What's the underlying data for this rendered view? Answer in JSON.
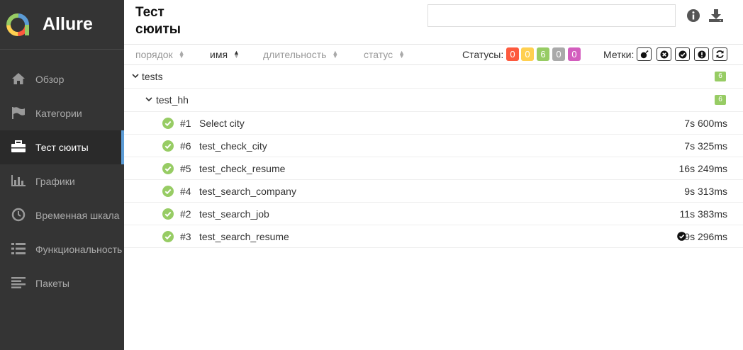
{
  "brand": {
    "name": "Allure"
  },
  "sidebar": {
    "items": [
      {
        "label": "Обзор",
        "icon": "home-icon",
        "active": false
      },
      {
        "label": "Категории",
        "icon": "flag-icon",
        "active": false
      },
      {
        "label": "Тест сюиты",
        "icon": "briefcase-icon",
        "active": true
      },
      {
        "label": "Графики",
        "icon": "bar-chart-icon",
        "active": false
      },
      {
        "label": "Временная шкала",
        "icon": "clock-icon",
        "active": false
      },
      {
        "label": "Функциональность",
        "icon": "list-icon",
        "active": false
      },
      {
        "label": "Пакеты",
        "icon": "align-left-icon",
        "active": false
      }
    ]
  },
  "header": {
    "title": "Тест сюиты",
    "search_value": "",
    "info_icon": "info-icon",
    "download_icon": "download-icon"
  },
  "toolbar": {
    "sorters": [
      {
        "label": "порядок",
        "active": false
      },
      {
        "label": "имя",
        "active": true
      },
      {
        "label": "длительность",
        "active": false
      },
      {
        "label": "статус",
        "active": false
      }
    ],
    "statuses_label": "Статусы:",
    "statuses": [
      {
        "name": "failed",
        "count": "0",
        "color": "#fd5a3e"
      },
      {
        "name": "broken",
        "count": "0",
        "color": "#ffd050"
      },
      {
        "name": "passed",
        "count": "6",
        "color": "#97cc64"
      },
      {
        "name": "skipped",
        "count": "0",
        "color": "#aaaaaa"
      },
      {
        "name": "unknown",
        "count": "0",
        "color": "#d35ebe"
      }
    ],
    "marks_label": "Метки:",
    "marks": [
      "bomb-icon",
      "times-circle-icon",
      "check-circle-icon",
      "exclamation-circle-icon",
      "refresh-icon"
    ]
  },
  "tree": {
    "groups": [
      {
        "name": "tests",
        "count": "6"
      },
      {
        "name": "test_hh",
        "count": "6"
      }
    ],
    "tests": [
      {
        "num": "#1",
        "name": "Select city",
        "duration": "7s 600ms",
        "flagged": false
      },
      {
        "num": "#6",
        "name": "test_check_city",
        "duration": "7s 325ms",
        "flagged": false
      },
      {
        "num": "#5",
        "name": "test_check_resume",
        "duration": "16s 249ms",
        "flagged": false
      },
      {
        "num": "#4",
        "name": "test_search_company",
        "duration": "9s 313ms",
        "flagged": false
      },
      {
        "num": "#2",
        "name": "test_search_job",
        "duration": "11s 383ms",
        "flagged": false
      },
      {
        "num": "#3",
        "name": "test_search_resume",
        "duration": "9s 296ms",
        "flagged": true
      }
    ]
  },
  "colors": {
    "sidebar_bg": "#343434",
    "accent": "#5b9bd5",
    "passed": "#97cc64"
  }
}
